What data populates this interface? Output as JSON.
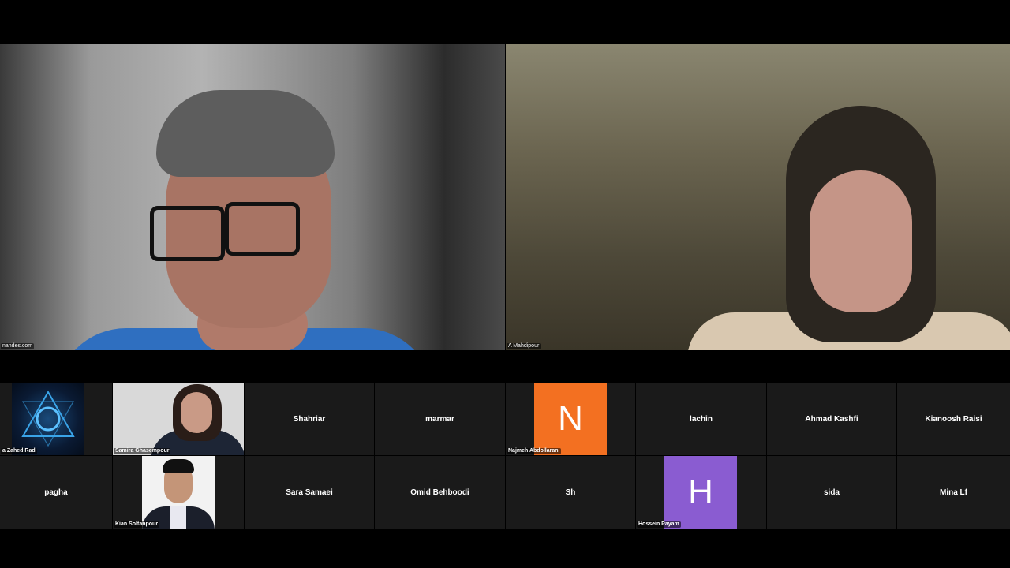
{
  "speakers": [
    {
      "name": "nandes.com"
    },
    {
      "name": "A Mahdipour"
    }
  ],
  "gallery": {
    "row1": [
      {
        "name": "a ZahediRad",
        "type": "video"
      },
      {
        "name": "Samira Ghasempour",
        "type": "video"
      },
      {
        "name": "Shahriar",
        "type": "name"
      },
      {
        "name": "marmar",
        "type": "name"
      },
      {
        "name": "Najmeh Abdollarani",
        "type": "avatar",
        "letter": "N",
        "color": "#f37021"
      },
      {
        "name": "lachin",
        "type": "name"
      },
      {
        "name": "Ahmad Kashfi",
        "type": "name"
      },
      {
        "name": "Kianoosh Raisi",
        "type": "name"
      }
    ],
    "row2": [
      {
        "name": "pagha",
        "type": "name"
      },
      {
        "name": "Kian Soltanpour",
        "type": "video"
      },
      {
        "name": "Sara Samaei",
        "type": "name"
      },
      {
        "name": "Omid Behboodi",
        "type": "name"
      },
      {
        "name": "Sh",
        "type": "name"
      },
      {
        "name": "Hossein Payam",
        "type": "avatar",
        "letter": "H",
        "color": "#8a5cd1"
      },
      {
        "name": "sida",
        "type": "name"
      },
      {
        "name": "Mina Lf",
        "type": "name"
      }
    ]
  }
}
